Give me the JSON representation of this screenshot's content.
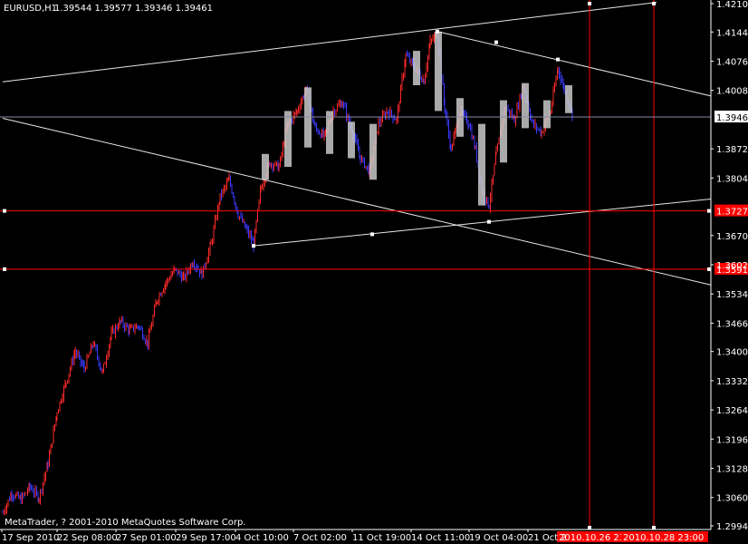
{
  "header": {
    "symbol_timeframe": "EURUSD,H1",
    "ohlc": "1.39544 1.39577 1.39346 1.39461"
  },
  "footer": {
    "copyright": "MetaTrader, ? 2001-2010 MetaQuotes Software Corp."
  },
  "colors": {
    "background": "#000000",
    "bull_candle": "#ff2a2a",
    "bear_candle": "#3a3aff",
    "highlight_bar": "#c8c8c8",
    "trendline": "#e6e6e6",
    "horizontal_line": "#ff0000",
    "vertical_line": "#ff0000",
    "price_marker_bg": "#ff0000",
    "current_price_bg": "#ffffff"
  },
  "chart_data": {
    "type": "candlestick",
    "symbol": "EURUSD",
    "timeframe": "H1",
    "ylim": [
      1.2994,
      1.421
    ],
    "y_ticks": [
      "1.42100",
      "1.41440",
      "1.40760",
      "1.40080",
      "1.39461",
      "1.38720",
      "1.38040",
      "1.37274",
      "1.36700",
      "1.36020",
      "1.35340",
      "1.34660",
      "1.34000",
      "1.33320",
      "1.32640",
      "1.31960",
      "1.31280",
      "1.30600",
      "1.29940"
    ],
    "x_ticks": [
      "17 Sep 2010",
      "22 Sep 08:00",
      "27 Sep 01:00",
      "29 Sep 17:00",
      "4 Oct 10:00",
      "7 Oct 02:00",
      "11 Oct 19:00",
      "14 Oct 11:00",
      "19 Oct 04:00",
      "21 Oct 2"
    ],
    "current_price": "1.39461",
    "horizontal_levels": [
      {
        "value": 1.37274,
        "label": "1.37274"
      },
      {
        "value": 1.35916,
        "label": "1.35916"
      }
    ],
    "vertical_markers": [
      {
        "label": "2010.10.26 23:00"
      },
      {
        "label": "2010.10.28 23:00"
      }
    ],
    "close_path": [
      {
        "x": 0,
        "y": 1.3025
      },
      {
        "x": 10,
        "y": 1.307
      },
      {
        "x": 20,
        "y": 1.3055
      },
      {
        "x": 30,
        "y": 1.3085
      },
      {
        "x": 40,
        "y": 1.306
      },
      {
        "x": 50,
        "y": 1.314
      },
      {
        "x": 60,
        "y": 1.326
      },
      {
        "x": 70,
        "y": 1.333
      },
      {
        "x": 80,
        "y": 1.34
      },
      {
        "x": 90,
        "y": 1.336
      },
      {
        "x": 100,
        "y": 1.342
      },
      {
        "x": 110,
        "y": 1.335
      },
      {
        "x": 120,
        "y": 1.344
      },
      {
        "x": 130,
        "y": 1.347
      },
      {
        "x": 140,
        "y": 1.345
      },
      {
        "x": 150,
        "y": 1.346
      },
      {
        "x": 160,
        "y": 1.342
      },
      {
        "x": 170,
        "y": 1.352
      },
      {
        "x": 180,
        "y": 1.356
      },
      {
        "x": 190,
        "y": 1.359
      },
      {
        "x": 200,
        "y": 1.357
      },
      {
        "x": 210,
        "y": 1.361
      },
      {
        "x": 220,
        "y": 1.358
      },
      {
        "x": 230,
        "y": 1.365
      },
      {
        "x": 240,
        "y": 1.376
      },
      {
        "x": 250,
        "y": 1.38
      },
      {
        "x": 260,
        "y": 1.372
      },
      {
        "x": 270,
        "y": 1.368
      },
      {
        "x": 277,
        "y": 1.365
      },
      {
        "x": 285,
        "y": 1.378
      },
      {
        "x": 295,
        "y": 1.384
      },
      {
        "x": 305,
        "y": 1.383
      },
      {
        "x": 315,
        "y": 1.393
      },
      {
        "x": 325,
        "y": 1.396
      },
      {
        "x": 335,
        "y": 1.401
      },
      {
        "x": 345,
        "y": 1.392
      },
      {
        "x": 355,
        "y": 1.39
      },
      {
        "x": 365,
        "y": 1.396
      },
      {
        "x": 375,
        "y": 1.398
      },
      {
        "x": 385,
        "y": 1.392
      },
      {
        "x": 395,
        "y": 1.385
      },
      {
        "x": 405,
        "y": 1.382
      },
      {
        "x": 415,
        "y": 1.393
      },
      {
        "x": 425,
        "y": 1.396
      },
      {
        "x": 435,
        "y": 1.394
      },
      {
        "x": 445,
        "y": 1.409
      },
      {
        "x": 455,
        "y": 1.406
      },
      {
        "x": 465,
        "y": 1.403
      },
      {
        "x": 472,
        "y": 1.412
      },
      {
        "x": 480,
        "y": 1.414
      },
      {
        "x": 488,
        "y": 1.397
      },
      {
        "x": 495,
        "y": 1.387
      },
      {
        "x": 505,
        "y": 1.396
      },
      {
        "x": 515,
        "y": 1.393
      },
      {
        "x": 522,
        "y": 1.387
      },
      {
        "x": 530,
        "y": 1.377
      },
      {
        "x": 537,
        "y": 1.374
      },
      {
        "x": 545,
        "y": 1.386
      },
      {
        "x": 555,
        "y": 1.397
      },
      {
        "x": 565,
        "y": 1.394
      },
      {
        "x": 575,
        "y": 1.402
      },
      {
        "x": 585,
        "y": 1.393
      },
      {
        "x": 595,
        "y": 1.391
      },
      {
        "x": 605,
        "y": 1.396
      },
      {
        "x": 613,
        "y": 1.406
      },
      {
        "x": 620,
        "y": 1.401
      },
      {
        "x": 630,
        "y": 1.3946
      }
    ],
    "highlight_bars": [
      {
        "x": 290,
        "hi": 1.386,
        "lo": 1.38
      },
      {
        "x": 315,
        "hi": 1.396,
        "lo": 1.383
      },
      {
        "x": 337,
        "hi": 1.4015,
        "lo": 1.3875
      },
      {
        "x": 361,
        "hi": 1.396,
        "lo": 1.386
      },
      {
        "x": 385,
        "hi": 1.3935,
        "lo": 1.385
      },
      {
        "x": 409,
        "hi": 1.393,
        "lo": 1.38
      },
      {
        "x": 457,
        "hi": 1.41,
        "lo": 1.402
      },
      {
        "x": 481,
        "hi": 1.4145,
        "lo": 1.396
      },
      {
        "x": 505,
        "hi": 1.399,
        "lo": 1.39
      },
      {
        "x": 529,
        "hi": 1.393,
        "lo": 1.374
      },
      {
        "x": 553,
        "hi": 1.3985,
        "lo": 1.384
      },
      {
        "x": 577,
        "hi": 1.4025,
        "lo": 1.392
      },
      {
        "x": 601,
        "hi": 1.3985,
        "lo": 1.392
      },
      {
        "x": 625,
        "hi": 1.402,
        "lo": 1.3955
      }
    ],
    "trendlines": [
      {
        "name": "upper-channel-line",
        "x1": 0,
        "y1": 1.4028,
        "x2": 722,
        "y2": 1.4213,
        "extend": false
      },
      {
        "name": "lower-channel-line",
        "x1": 0,
        "y1": 1.3943,
        "x2": 785,
        "y2": 1.3555,
        "extend": false
      },
      {
        "name": "upper-right-line",
        "x1": 480,
        "y1": 1.4145,
        "x2": 785,
        "y2": 1.3995,
        "extend": false
      },
      {
        "name": "lower-support-line",
        "x1": 277,
        "y1": 1.3646,
        "x2": 785,
        "y2": 1.3755,
        "extend": false
      }
    ],
    "anchors": [
      {
        "x": 480,
        "y": 1.4145
      },
      {
        "x": 545,
        "y": 1.412
      },
      {
        "x": 613,
        "y": 1.408
      },
      {
        "x": 277,
        "y": 1.3646
      },
      {
        "x": 408,
        "y": 1.3673
      },
      {
        "x": 537,
        "y": 1.3702
      }
    ]
  }
}
